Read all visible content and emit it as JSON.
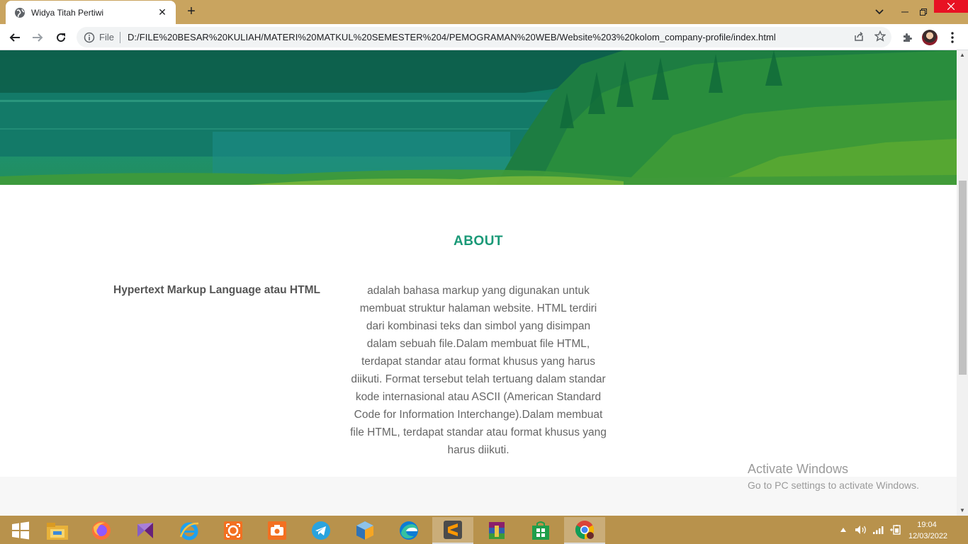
{
  "browser": {
    "tab_title": "Widya Titah Pertiwi",
    "tab_close": "✕",
    "new_tab": "+",
    "scheme_label": "File",
    "url": "D:/FILE%20BESAR%20KULIAH/MATERI%20MATKUL%20SEMESTER%204/PEMOGRAMAN%20WEB/Website%203%20kolom_company-profile/index.html"
  },
  "about": {
    "heading": "ABOUT",
    "term": "Hypertext Markup Language atau HTML",
    "description": "adalah bahasa markup yang digunakan untuk membuat struktur halaman website. HTML terdiri dari kombinasi teks dan simbol yang disimpan dalam sebuah file.Dalam membuat file HTML, terdapat standar atau format khusus yang harus diikuti. Format tersebut telah tertuang dalam standar kode internasional atau ASCII (American Standard Code for Information Interchange).Dalam membuat file HTML, terdapat standar atau format khusus yang harus diikuti."
  },
  "watermark": {
    "line1": "Activate Windows",
    "line2": "Go to PC settings to activate Windows."
  },
  "taskbar": {
    "time": "19:04",
    "date": "12/03/2022",
    "apps": [
      "start-icon",
      "file-explorer-icon",
      "firefox-icon",
      "visual-studio-icon",
      "internet-explorer-icon",
      "screenshot-tool-icon",
      "camera-app-icon",
      "telegram-icon",
      "virtualbox-icon",
      "edge-icon",
      "sublime-text-icon",
      "winrar-icon",
      "store-icon",
      "chrome-icon"
    ]
  },
  "colors": {
    "tabbar": "#c9a45f",
    "accent": "#1a9977",
    "taskbar": "#b8924c"
  }
}
